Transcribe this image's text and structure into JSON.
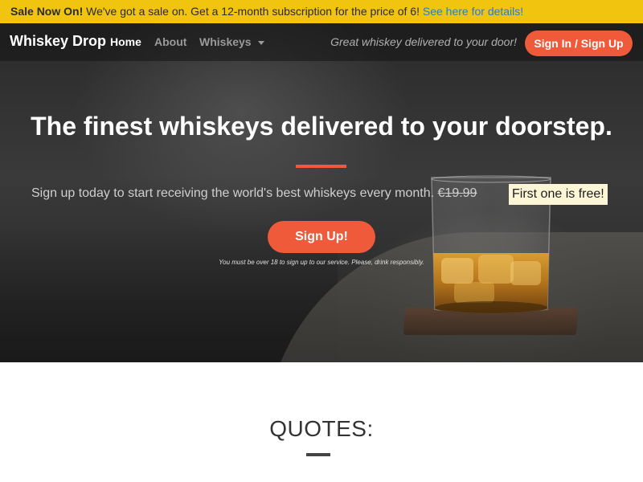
{
  "sale_banner": {
    "strong": "Sale Now On!",
    "text": " We've got a sale on. Get a 12-month subscription for the price of 6! ",
    "link": "See here for details!"
  },
  "navbar": {
    "brand": "Whiskey Drop",
    "links": [
      {
        "label": "Home",
        "active": true
      },
      {
        "label": "About",
        "active": false
      },
      {
        "label": "Whiskeys",
        "active": false,
        "dropdown": true
      }
    ],
    "tagline": "Great whiskey delivered to your door!",
    "signin_label": "Sign In / Sign Up"
  },
  "hero": {
    "title": "The finest whiskeys delivered to your doorstep.",
    "subtitle": "Sign up today to start receiving the world's best whiskeys every month. ",
    "old_price": "€19.99",
    "free_badge": "First one is free!",
    "cta_label": "Sign Up!",
    "disclaimer": "You must be over 18 to sign up to our service. Please, drink responsibly."
  },
  "quotes": {
    "title": "QUOTES:"
  },
  "colors": {
    "banner": "#f1c40f",
    "accent": "#ef5a3a",
    "link": "#1f7ed8",
    "badge_bg": "#fdf6d6"
  },
  "icons": {
    "dropdown": "chevron-down-icon"
  }
}
